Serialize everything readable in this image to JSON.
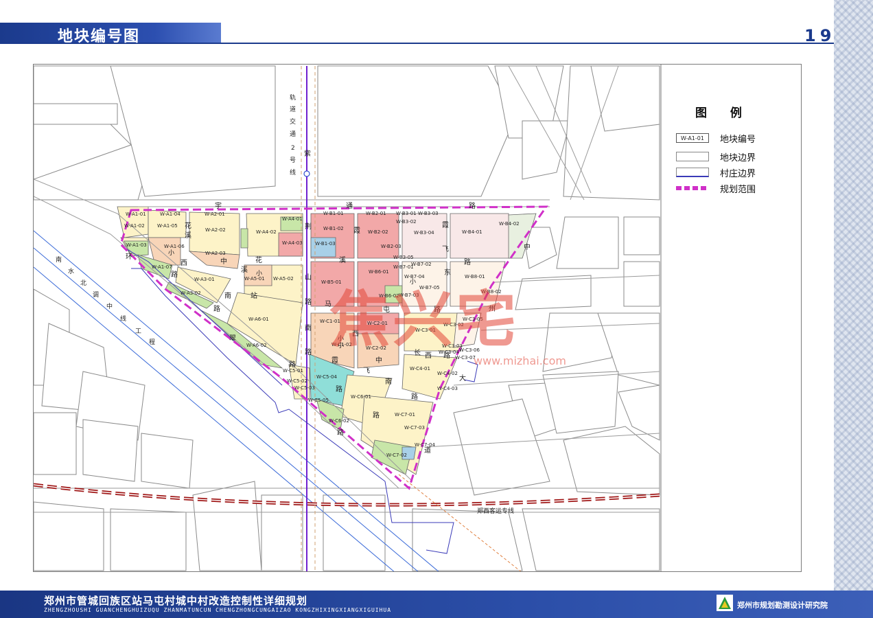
{
  "header": {
    "title": "地块编号图",
    "page_number": "19"
  },
  "legend": {
    "title": "图 例",
    "items": [
      {
        "label": "地块编号",
        "sample": "W-A1-01"
      },
      {
        "label": "地块边界",
        "sample": ""
      },
      {
        "label": "村庄边界",
        "sample": ""
      },
      {
        "label": "规划范围",
        "sample": ""
      }
    ]
  },
  "colors": {
    "residential": "#fdf3c8",
    "green": "#c8e6a8",
    "commercial": "#f2a8a8",
    "education": "#f8d5b8",
    "facility": "#a8d0e8",
    "school_green": "#8fded8",
    "village_boundary": "#3a3ab8",
    "plan_boundary": "#d030c8",
    "railway": "#a01818",
    "accent": "#1b3a8c"
  },
  "map": {
    "rail_line_label": [
      "轨",
      "道",
      "交",
      "通",
      "2",
      "号",
      "线"
    ],
    "canal_label": [
      "南",
      "水",
      "北",
      "调",
      "中",
      "线",
      "工",
      "程"
    ],
    "railway_label": "郑西客运专线",
    "road_labels": [
      {
        "text": "紫",
        "key": "zi"
      },
      {
        "text": "宇",
        "key": "yu"
      },
      {
        "text": "通",
        "key": "tong"
      },
      {
        "text": "路",
        "key": "lu1"
      },
      {
        "text": "荆",
        "key": "jing"
      },
      {
        "text": "霞",
        "key": "xia1"
      },
      {
        "text": "霞",
        "key": "xia2"
      },
      {
        "text": "中",
        "key": "zhong1"
      },
      {
        "text": "飞",
        "key": "fei1"
      },
      {
        "text": "路",
        "key": "lu2"
      },
      {
        "text": "东",
        "key": "dong"
      },
      {
        "text": "环",
        "key": "huan"
      },
      {
        "text": "花",
        "key": "hua1"
      },
      {
        "text": "溪",
        "key": "xi1"
      },
      {
        "text": "西",
        "key": "xi2"
      },
      {
        "text": "路",
        "key": "lu3"
      },
      {
        "text": "中",
        "key": "zhong2"
      },
      {
        "text": "花",
        "key": "hua2"
      },
      {
        "text": "溪",
        "key": "xi3"
      },
      {
        "text": "溪",
        "key": "xi4"
      },
      {
        "text": "山",
        "key": "shan"
      },
      {
        "text": "路",
        "key": "lu4"
      },
      {
        "text": "南",
        "key": "nan1"
      },
      {
        "text": "站",
        "key": "zhan"
      },
      {
        "text": "路",
        "key": "lu5"
      },
      {
        "text": "马",
        "key": "ma"
      },
      {
        "text": "屯",
        "key": "tun"
      },
      {
        "text": "路",
        "key": "lu6"
      },
      {
        "text": "南",
        "key": "nan2"
      },
      {
        "text": "翠",
        "key": "cui"
      },
      {
        "text": "西",
        "key": "xi5"
      },
      {
        "text": "路",
        "key": "lu7"
      },
      {
        "text": "路",
        "key": "lu8"
      },
      {
        "text": "霞",
        "key": "xia3"
      },
      {
        "text": "长",
        "key": "chang"
      },
      {
        "text": "西",
        "key": "xi6"
      },
      {
        "text": "路",
        "key": "lu9"
      },
      {
        "text": "大",
        "key": "da"
      },
      {
        "text": "州",
        "key": "zhou"
      },
      {
        "text": "路",
        "key": "lu10"
      },
      {
        "text": "路",
        "key": "lu11"
      },
      {
        "text": "南",
        "key": "nan3"
      },
      {
        "text": "路",
        "key": "lu12"
      },
      {
        "text": "道",
        "key": "dao"
      },
      {
        "text": "中",
        "key": "zhong3"
      },
      {
        "text": "路",
        "key": "lu13"
      },
      {
        "text": "飞",
        "key": "fei2"
      }
    ],
    "small_labels": [
      "小",
      "小",
      "小",
      "小",
      "小"
    ],
    "parcels": [
      "W-A1-01",
      "W-A1-02",
      "W-A1-03",
      "W-A1-04",
      "W-A1-05",
      "W-A1-06",
      "W-A1-07",
      "W-A2-01",
      "W-A2-02",
      "W-A2-03",
      "W-A3-01",
      "W-A3-02",
      "W-A4-01",
      "W-A4-02",
      "W-A4-03",
      "W-A5-01",
      "W-A5-02",
      "W-A6-01",
      "W-A6-02",
      "W-B1-01",
      "W-B1-02",
      "W-B1-03",
      "W-B2-01",
      "W-B2-02",
      "W-B2-03",
      "W-B3-01",
      "W-B3-02",
      "W-B3-03",
      "W-B3-04",
      "W-B3-05",
      "W-B4-01",
      "W-B4-02",
      "W-B5-01",
      "W-B6-01",
      "W-B6-02",
      "W-B7-01",
      "W-B7-02",
      "W-B7-03",
      "W-B7-04",
      "W-B7-05",
      "W-B8-01",
      "W-B8-02",
      "W-C1-01",
      "W-C1-02",
      "W-C2-01",
      "W-C2-02",
      "W-C3-01",
      "W-C3-02",
      "W-C3-03",
      "W-C3-04",
      "W-C3-05",
      "W-C3-06",
      "W-C3-07",
      "W-C4-01",
      "W-C4-02",
      "W-C4-03",
      "W-C5-01",
      "W-C5-02",
      "W-C5-03",
      "W-C5-04",
      "W-C5-05",
      "W-C6-01",
      "W-C6-02",
      "W-C7-01",
      "W-C7-02",
      "W-C7-03",
      "W-C7-04"
    ]
  },
  "watermark": {
    "text": "焦兴宅",
    "url": "www.mizhai.com"
  },
  "footer": {
    "title": "郑州市管城回族区站马屯村城中村改造控制性详细规划",
    "subtitle": "ZHENGZHOUSHI GUANCHENGHUIZUQU ZHANMATUNCUN CHENGZHONGCUNGAIZAO KONGZHIXINGXIANGXIGUIHUA",
    "institute": "郑州市规划勘测设计研究院"
  }
}
